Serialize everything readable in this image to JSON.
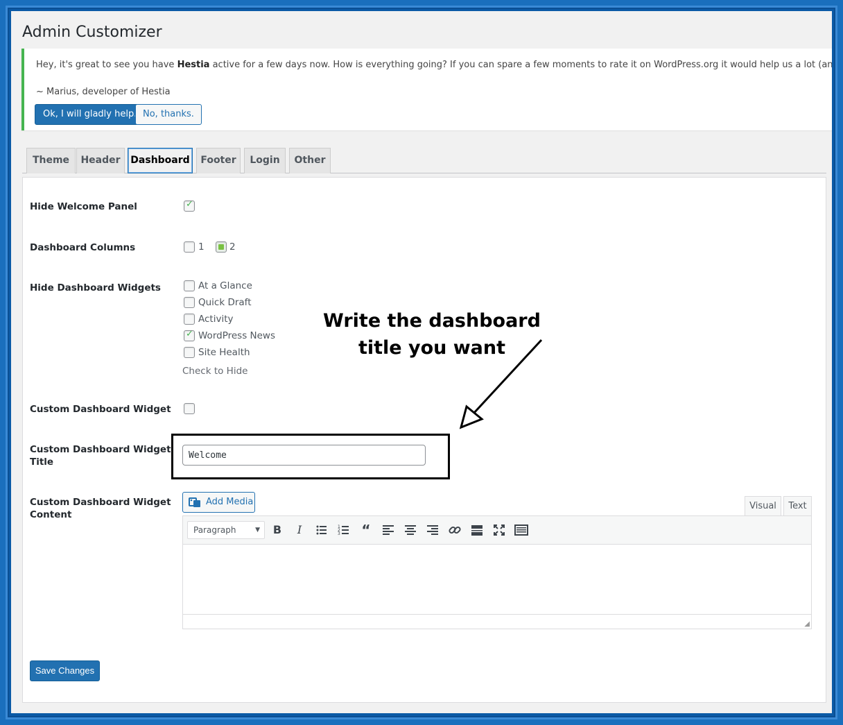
{
  "page": {
    "title": "Admin Customizer"
  },
  "notice": {
    "text_before": "Hey, it's great to see you have ",
    "theme_name": "Hestia",
    "text_after": " active for a few days now. How is everything going? If you can spare a few moments to rate it on WordPress.org it would help us a lot (and boost my motivation). C",
    "signature": "~ Marius, developer of Hestia",
    "accept_label": "Ok, I will gladly help.",
    "decline_label": "No, thanks."
  },
  "tabs": [
    {
      "label": "Theme"
    },
    {
      "label": "Header"
    },
    {
      "label": "Dashboard",
      "active": true
    },
    {
      "label": "Footer"
    },
    {
      "label": "Login"
    },
    {
      "label": "Other"
    }
  ],
  "settings": {
    "hide_welcome": {
      "label": "Hide Welcome Panel",
      "checked": true
    },
    "columns": {
      "label": "Dashboard Columns",
      "options": [
        {
          "value": "1",
          "checked": false
        },
        {
          "value": "2",
          "checked": true
        }
      ]
    },
    "hide_widgets": {
      "label": "Hide Dashboard Widgets",
      "options": [
        {
          "label": "At a Glance",
          "checked": false
        },
        {
          "label": "Quick Draft",
          "checked": false
        },
        {
          "label": "Activity",
          "checked": false
        },
        {
          "label": "WordPress News",
          "checked": true
        },
        {
          "label": "Site Health",
          "checked": false
        }
      ],
      "hint": "Check to Hide"
    },
    "custom_widget": {
      "label": "Custom Dashboard Widget",
      "checked": false
    },
    "custom_widget_title": {
      "label_line1": "Custom Dashboard Widget",
      "label_line2": "Title",
      "value": "Welcome"
    },
    "custom_widget_content": {
      "label_line1": "Custom Dashboard Widget",
      "label_line2": "Content",
      "add_media_label": "Add Media",
      "tab_visual": "Visual",
      "tab_text": "Text",
      "format_selected": "Paragraph"
    }
  },
  "annotation": {
    "line1": "Write the dashboard",
    "line2": "title you want"
  },
  "save_label": "Save Changes",
  "colors": {
    "accent": "#2271b1",
    "notice_border": "#46b450",
    "background_frame": "#1a6fbd"
  }
}
